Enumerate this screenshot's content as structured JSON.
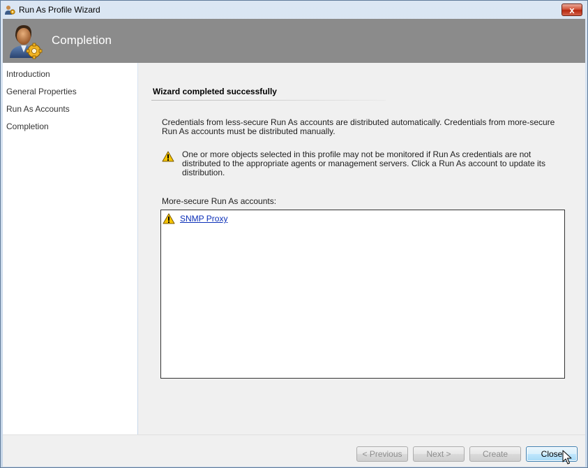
{
  "window": {
    "title": "Run As Profile Wizard",
    "close_glyph": "x"
  },
  "header": {
    "title": "Completion",
    "icon": "user-gear-icon"
  },
  "nav": {
    "items": [
      {
        "label": "Introduction"
      },
      {
        "label": "General Properties"
      },
      {
        "label": "Run As Accounts"
      },
      {
        "label": "Completion"
      }
    ]
  },
  "main": {
    "section_title": "Wizard completed successfully",
    "info": "Credentials from less-secure Run As accounts are distributed automatically. Credentials from more-secure Run As accounts must be distributed manually.",
    "warning": "One or more objects selected in this profile may not be monitored if Run As credentials are not distributed to the appropriate agents or management servers. Click a Run As account to update its distribution.",
    "list_label": "More-secure Run As accounts:",
    "accounts": [
      {
        "name": "SNMP Proxy",
        "icon": "warning-icon"
      }
    ]
  },
  "footer": {
    "previous": "< Previous",
    "next": "Next >",
    "create": "Create",
    "close": "Close"
  },
  "colors": {
    "header_bg": "#8b8b8b",
    "link": "#0b2fb8",
    "warning": "#f5c400"
  }
}
